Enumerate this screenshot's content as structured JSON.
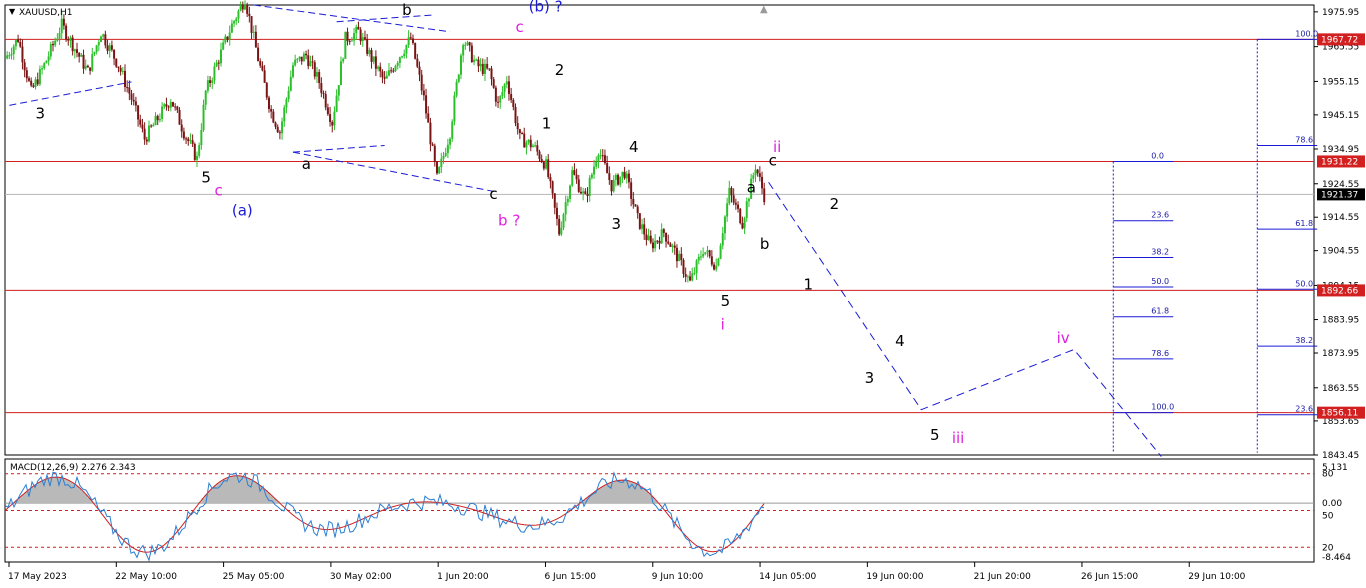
{
  "chart_title": "XAUUSD,H1",
  "chart_data": {
    "type": "candlestick",
    "symbol": "XAUUSD,H1",
    "price_axis": [
      "1975.95",
      "1965.55",
      "1955.15",
      "1945.15",
      "1934.95",
      "1924.55",
      "1914.55",
      "1904.55",
      "1894.15",
      "1883.95",
      "1873.95",
      "1863.55",
      "1853.65",
      "1843.45"
    ],
    "price_range": [
      1843.45,
      1978.0
    ],
    "time_axis": [
      "17 May 2023",
      "22 May 10:00",
      "25 May 05:00",
      "30 May 02:00",
      "1 Jun 20:00",
      "6 Jun 15:00",
      "9 Jun 10:00",
      "14 Jun 05:00",
      "19 Jun 00:00",
      "21 Jun 20:00",
      "26 Jun 15:00",
      "29 Jun 10:00"
    ],
    "horizontal_levels": [
      {
        "value": 1967.72,
        "label": "1967.72",
        "color": "#d21f1f"
      },
      {
        "value": 1931.22,
        "label": "1931.22",
        "color": "#d21f1f"
      },
      {
        "value": 1892.66,
        "label": "1892.66",
        "color": "#d21f1f"
      },
      {
        "value": 1856.11,
        "label": "1856.11",
        "color": "#d21f1f"
      }
    ],
    "current_price": {
      "value": 1921.37,
      "label": "1921.37"
    },
    "price_path": [
      {
        "t": 0,
        "p": 1962
      },
      {
        "t": 3,
        "p": 1968
      },
      {
        "t": 6,
        "p": 1952
      },
      {
        "t": 9,
        "p": 1960
      },
      {
        "t": 13,
        "p": 1972
      },
      {
        "t": 16,
        "p": 1965
      },
      {
        "t": 19,
        "p": 1958
      },
      {
        "t": 22,
        "p": 1970
      },
      {
        "t": 26,
        "p": 1960
      },
      {
        "t": 29,
        "p": 1950
      },
      {
        "t": 32,
        "p": 1938
      },
      {
        "t": 35,
        "p": 1944
      },
      {
        "t": 38,
        "p": 1950
      },
      {
        "t": 41,
        "p": 1940
      },
      {
        "t": 44,
        "p": 1932
      },
      {
        "t": 46,
        "p": 1952
      },
      {
        "t": 49,
        "p": 1962
      },
      {
        "t": 52,
        "p": 1972
      },
      {
        "t": 55,
        "p": 1980
      },
      {
        "t": 58,
        "p": 1962
      },
      {
        "t": 61,
        "p": 1946
      },
      {
        "t": 63,
        "p": 1940
      },
      {
        "t": 66,
        "p": 1960
      },
      {
        "t": 69,
        "p": 1963
      },
      {
        "t": 72,
        "p": 1955
      },
      {
        "t": 75,
        "p": 1943
      },
      {
        "t": 78,
        "p": 1968
      },
      {
        "t": 81,
        "p": 1970
      },
      {
        "t": 84,
        "p": 1962
      },
      {
        "t": 87,
        "p": 1955
      },
      {
        "t": 90,
        "p": 1962
      },
      {
        "t": 93,
        "p": 1968
      },
      {
        "t": 96,
        "p": 1950
      },
      {
        "t": 99,
        "p": 1926
      },
      {
        "t": 102,
        "p": 1940
      },
      {
        "t": 105,
        "p": 1968
      },
      {
        "t": 108,
        "p": 1960
      },
      {
        "t": 111,
        "p": 1958
      },
      {
        "t": 113,
        "p": 1948
      },
      {
        "t": 115,
        "p": 1956
      },
      {
        "t": 118,
        "p": 1938
      },
      {
        "t": 121,
        "p": 1936
      },
      {
        "t": 124,
        "p": 1930
      },
      {
        "t": 127,
        "p": 1910
      },
      {
        "t": 130,
        "p": 1928
      },
      {
        "t": 133,
        "p": 1920
      },
      {
        "t": 136,
        "p": 1935
      },
      {
        "t": 139,
        "p": 1924
      },
      {
        "t": 142,
        "p": 1928
      },
      {
        "t": 145,
        "p": 1914
      },
      {
        "t": 148,
        "p": 1906
      },
      {
        "t": 151,
        "p": 1910
      },
      {
        "t": 154,
        "p": 1903
      },
      {
        "t": 157,
        "p": 1895
      },
      {
        "t": 160,
        "p": 1905
      },
      {
        "t": 163,
        "p": 1900
      },
      {
        "t": 166,
        "p": 1922
      },
      {
        "t": 169,
        "p": 1913
      },
      {
        "t": 172,
        "p": 1930
      },
      {
        "t": 174,
        "p": 1921
      }
    ],
    "projection": [
      {
        "t": 175,
        "p": 1925
      },
      {
        "t": 210,
        "p": 1857
      },
      {
        "t": 245,
        "p": 1875
      },
      {
        "t": 265,
        "p": 1843
      }
    ],
    "trendlines": [
      {
        "a": {
          "t": 1,
          "p": 1948
        },
        "b": {
          "t": 29,
          "p": 1955
        }
      },
      {
        "a": {
          "t": 57,
          "p": 1978
        },
        "b": {
          "t": 102,
          "p": 1970
        }
      },
      {
        "a": {
          "t": 66,
          "p": 1934
        },
        "b": {
          "t": 113,
          "p": 1922
        }
      },
      {
        "a": {
          "t": 76,
          "p": 1973
        },
        "b": {
          "t": 98,
          "p": 1975
        }
      },
      {
        "a": {
          "t": 66,
          "p": 1934
        },
        "b": {
          "t": 87,
          "p": 1936
        }
      }
    ],
    "wave_labels": [
      {
        "text": "3",
        "t": 7,
        "p": 1944,
        "color": "#000000"
      },
      {
        "text": "5",
        "t": 45,
        "p": 1925,
        "color": "#000000"
      },
      {
        "text": "c",
        "t": 48,
        "p": 1921,
        "color": "#e020e0"
      },
      {
        "text": "(a)",
        "t": 52,
        "p": 1915,
        "color": "#1a1ad6"
      },
      {
        "text": "a",
        "t": 68,
        "p": 1929,
        "color": "#000000"
      },
      {
        "text": "b",
        "t": 91,
        "p": 1975,
        "color": "#000000"
      },
      {
        "text": "(b) ?",
        "t": 120,
        "p": 1976,
        "color": "#1a1ad6"
      },
      {
        "text": "c",
        "t": 117,
        "p": 1970,
        "color": "#e020e0"
      },
      {
        "text": "c",
        "t": 111,
        "p": 1920,
        "color": "#000000"
      },
      {
        "text": "b ?",
        "t": 113,
        "p": 1912,
        "color": "#e020e0"
      },
      {
        "text": "2",
        "t": 126,
        "p": 1957,
        "color": "#000000"
      },
      {
        "text": "1",
        "t": 123,
        "p": 1941,
        "color": "#000000"
      },
      {
        "text": "4",
        "t": 143,
        "p": 1934,
        "color": "#000000"
      },
      {
        "text": "3",
        "t": 139,
        "p": 1911,
        "color": "#000000"
      },
      {
        "text": "a",
        "t": 170,
        "p": 1922,
        "color": "#000000"
      },
      {
        "text": "c",
        "t": 175,
        "p": 1930,
        "color": "#000000"
      },
      {
        "text": "ii",
        "t": 176,
        "p": 1934,
        "color": "#e020e0"
      },
      {
        "text": "b",
        "t": 173,
        "p": 1905,
        "color": "#000000"
      },
      {
        "text": "2",
        "t": 189,
        "p": 1917,
        "color": "#000000"
      },
      {
        "text": "5",
        "t": 164,
        "p": 1888,
        "color": "#000000"
      },
      {
        "text": "i",
        "t": 164,
        "p": 1881,
        "color": "#e020e0"
      },
      {
        "text": "1",
        "t": 183,
        "p": 1893,
        "color": "#000000"
      },
      {
        "text": "4",
        "t": 204,
        "p": 1876,
        "color": "#000000"
      },
      {
        "text": "3",
        "t": 197,
        "p": 1865,
        "color": "#000000"
      },
      {
        "text": "5",
        "t": 212,
        "p": 1848,
        "color": "#000000"
      },
      {
        "text": "iii",
        "t": 217,
        "p": 1847,
        "color": "#e020e0"
      },
      {
        "text": "iv",
        "t": 241,
        "p": 1877,
        "color": "#e020e0"
      }
    ],
    "fib_retracement_1": {
      "t": 254,
      "high": 1931.22,
      "low": 1856.11,
      "levels": [
        {
          "label": "0.0",
          "value": 1931.22
        },
        {
          "label": "23.6",
          "value": 1913.5
        },
        {
          "label": "38.2",
          "value": 1902.5
        },
        {
          "label": "50.0",
          "value": 1893.7
        },
        {
          "label": "61.8",
          "value": 1884.8
        },
        {
          "label": "78.6",
          "value": 1872.2
        },
        {
          "label": "100.0",
          "value": 1856.11
        }
      ]
    },
    "fib_retracement_2": {
      "t": 287,
      "high": 1967.72,
      "low": 1856.11,
      "levels": [
        {
          "label": "100.0",
          "value": 1967.72
        },
        {
          "label": "78.6",
          "value": 1936.0
        },
        {
          "label": "61.8",
          "value": 1911.0
        },
        {
          "label": "50.0",
          "value": 1893.0
        },
        {
          "label": "38.2",
          "value": 1876.0
        },
        {
          "label": "23.6",
          "value": 1855.5
        }
      ]
    },
    "macd": {
      "title": "MACD(12,26,9) 2.276 2.343",
      "axis": [
        "5.131",
        "0.00",
        "-8.464"
      ],
      "levels": [
        {
          "label": "80",
          "value": 80
        },
        {
          "label": "50",
          "value": 50
        },
        {
          "label": "20",
          "value": 20
        }
      ],
      "range": [
        8,
        92
      ]
    }
  }
}
